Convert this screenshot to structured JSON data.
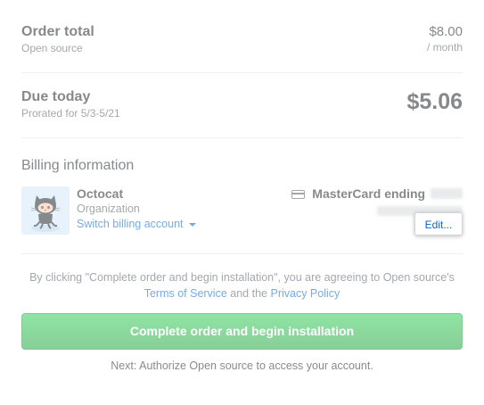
{
  "order": {
    "title": "Order total",
    "plan": "Open source",
    "price": "$8.00",
    "period": "/ month"
  },
  "due": {
    "title": "Due today",
    "prorated": "Prorated for 5/3-5/21",
    "amount": "$5.06"
  },
  "billing": {
    "heading": "Billing information",
    "account_name": "Octocat",
    "account_type": "Organization",
    "switch_label": "Switch billing account",
    "card_label": "MasterCard ending",
    "edit_label": "Edit..."
  },
  "agreement": {
    "prefix": "By clicking \"Complete order and begin installation\", you are agreeing to Open source's",
    "terms_link": "Terms of Service",
    "middle": "and the",
    "privacy_link": "Privacy Policy"
  },
  "cta": {
    "label": "Complete order and begin installation"
  },
  "next": {
    "text": "Next: Authorize Open source to access your account."
  },
  "colors": {
    "accent": "#0366d6",
    "cta_green": "#28a745"
  },
  "icons": {
    "card": "credit-card-icon",
    "caret": "caret-down-icon",
    "avatar": "octocat-avatar"
  }
}
